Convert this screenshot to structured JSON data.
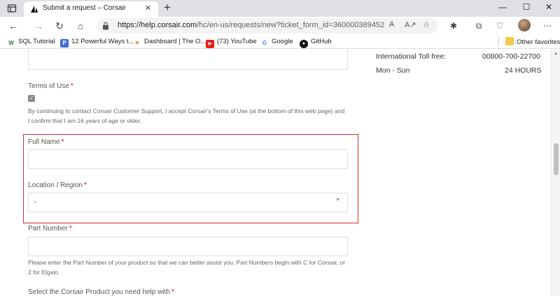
{
  "browser": {
    "tab": {
      "title": "Submit a request – Corsair"
    },
    "url": {
      "domain": "https://help.corsair.com",
      "path": "/hc/en-us/requests/new?ticket_form_id=360000389452"
    },
    "bookmarks": [
      {
        "label": "SQL Tutorial",
        "icon": "W",
        "color": "#2e7d32",
        "bg": "#fff"
      },
      {
        "label": "12 Powerful Ways t...",
        "icon": "P",
        "color": "#fff",
        "bg": "#3f6fd6"
      },
      {
        "label": "Dashboard | The O...",
        "icon": "✶",
        "color": "#c58a2a",
        "bg": "#fff"
      },
      {
        "label": "(73) YouTube",
        "icon": "▶",
        "color": "#fff",
        "bg": "#e62117"
      },
      {
        "label": "Google",
        "icon": "G",
        "color": "#4285f4",
        "bg": "#fff"
      },
      {
        "label": "GitHub",
        "icon": "●",
        "color": "#111",
        "bg": "#fff"
      }
    ],
    "other_favorites": "Other favorites"
  },
  "form": {
    "terms_label": "Terms of Use",
    "terms_text_1": "By continuing to contact Corsair Customer Support, I accept Corsair's Terms of Use (at the bottom of this web page) and",
    "terms_text_2": "I confirm that I am 16 years of age or older.",
    "full_name_label": "Full Name",
    "location_label": "Location / Region",
    "location_value": "-",
    "part_number_label": "Part Number",
    "part_number_help_1": "Please enter the Part Number of your product so that we can better assist you. Part Numbers begin with C for Corsair, or",
    "part_number_help_2": "2 for Elgato",
    "product_label": "Select the Corsair Product you need help with",
    "required_mark": "*"
  },
  "sidebar": {
    "rows": [
      {
        "label": "International Toll free:",
        "value": "00800-700-22700"
      },
      {
        "label": "Mon - Sun",
        "value": "24 HOURS"
      }
    ]
  }
}
